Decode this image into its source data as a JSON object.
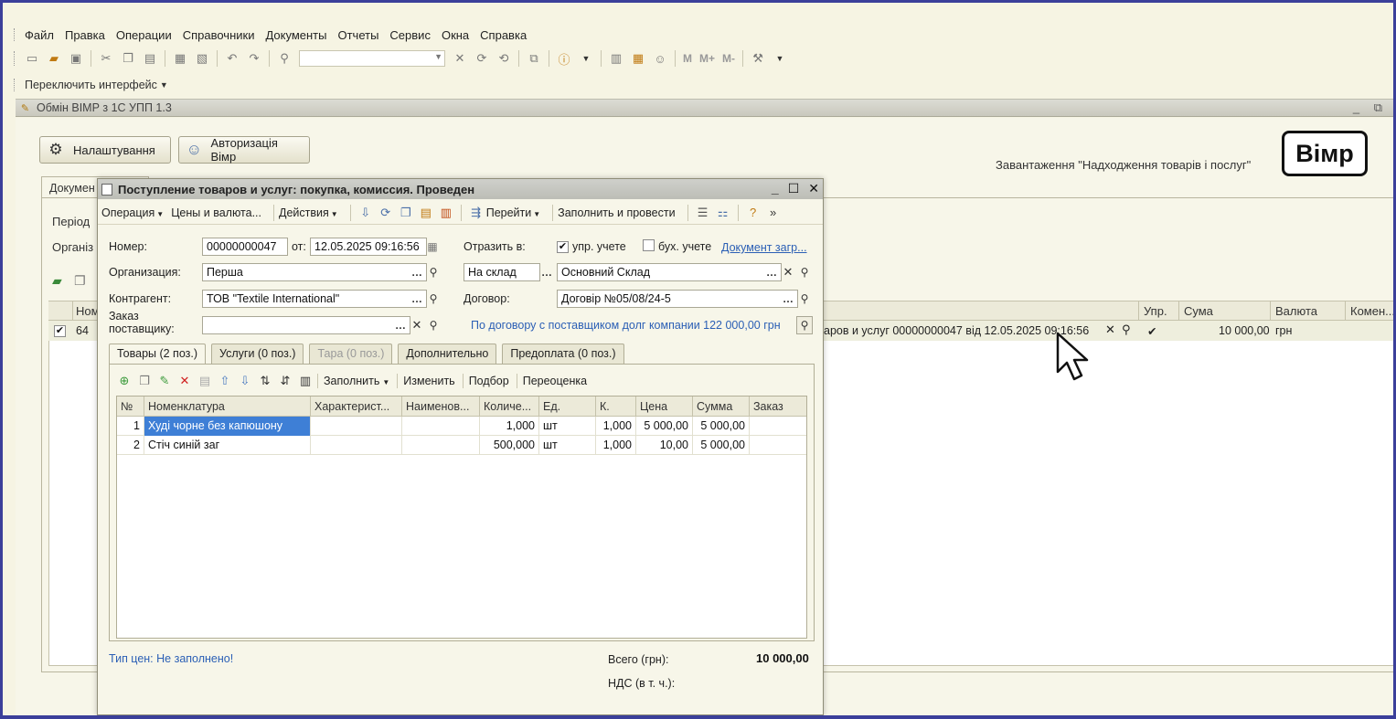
{
  "menu": [
    "Файл",
    "Правка",
    "Операции",
    "Справочники",
    "Документы",
    "Отчеты",
    "Сервис",
    "Окна",
    "Справка"
  ],
  "interface_switch": "Переключить интерфейс",
  "toolbar": {
    "marks": [
      "M",
      "M+",
      "M-"
    ]
  },
  "bg_window": {
    "title": "Обмін ВІМР з 1С УПП 1.3",
    "settings_button": "Налаштування",
    "auth_button": "Авторизація Вімр",
    "load_label": "Завантаження \"Надходження товарів і послуг\"",
    "logo": "Вімр",
    "tab": "Докумен",
    "period_label": "Період",
    "org_label": "Організ",
    "grid": {
      "headers": {
        "num": "Ном",
        "upr": "Упр.",
        "sum": "Сума",
        "currency": "Валюта",
        "comment": "Комен..."
      },
      "row": {
        "num": "64",
        "doc": "аров и услуг 00000000047 від 12.05.2025 09:16:56",
        "upr": "✔",
        "sum": "10 000,00",
        "currency": "грн"
      }
    }
  },
  "doc": {
    "title": "Поступление товаров и услуг: покупка, комиссия. Проведен",
    "toolbar": {
      "operation": "Операция",
      "prices": "Цены и валюта...",
      "actions": "Действия",
      "goto": "Перейти",
      "fill_post": "Заполнить и провести"
    },
    "number_label": "Номер:",
    "number": "00000000047",
    "date_label": "от:",
    "date": "12.05.2025 09:16:56",
    "reflect_label": "Отразить в:",
    "upr_label": "упр. учете",
    "buh_label": "бух. учете",
    "doc_load_link": "Документ загр...",
    "org_label": "Организация:",
    "org": "Перша",
    "to_stock": "На склад",
    "stock": "Основний Склад",
    "contractor_label": "Контрагент:",
    "contractor": "ТОВ \"Textile International\"",
    "contract_label": "Договор:",
    "contract": "Договір №05/08/24-5",
    "order_label_1": "Заказ",
    "order_label_2": "поставщику:",
    "debt_text": "По договору с поставщиком долг компании 122 000,00 грн",
    "tabs": [
      "Товары (2 поз.)",
      "Услуги (0 поз.)",
      "Тара (0 поз.)",
      "Дополнительно",
      "Предоплата (0 поз.)"
    ],
    "tab_tools": {
      "fill": "Заполнить",
      "change": "Изменить",
      "pick": "Подбор",
      "reprice": "Переоценка"
    },
    "columns": [
      "№",
      "Номенклатура",
      "Характерист...",
      "Наименов...",
      "Количе...",
      "Ед.",
      "К.",
      "Цена",
      "Сумма",
      "Заказ"
    ],
    "rows": [
      {
        "n": "1",
        "name": "Худі чорне без капюшону",
        "char": "",
        "naim": "",
        "qty": "1,000",
        "unit": "шт",
        "k": "1,000",
        "price": "5 000,00",
        "sum": "5 000,00",
        "order": ""
      },
      {
        "n": "2",
        "name": "Стіч синій заг",
        "char": "",
        "naim": "",
        "qty": "500,000",
        "unit": "шт",
        "k": "1,000",
        "price": "10,00",
        "sum": "5 000,00",
        "order": ""
      }
    ],
    "price_type": "Тип цен: Не заполнено!",
    "total_label": "Всего (грн):",
    "total": "10 000,00",
    "vat_label": "НДС (в т. ч.):"
  }
}
